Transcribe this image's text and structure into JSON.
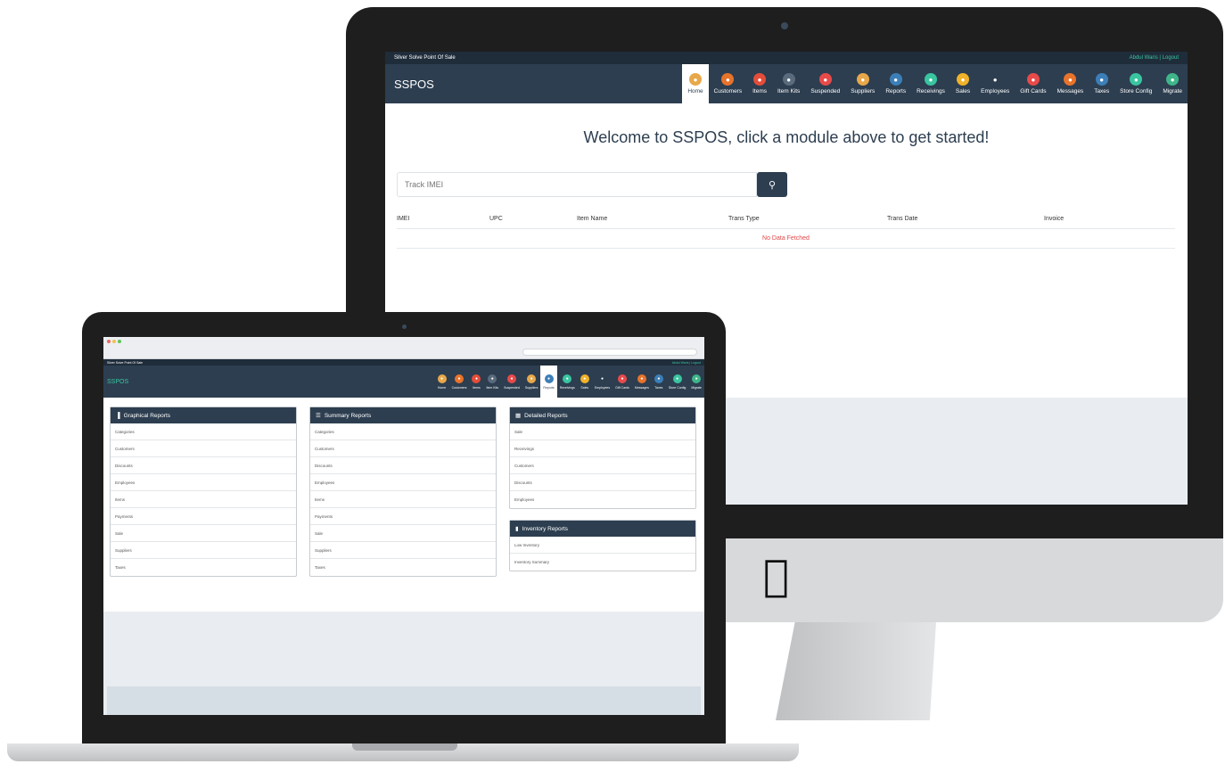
{
  "imac": {
    "topbar": {
      "app_name": "Silver Solve Point Of Sale",
      "user_links": "Abdul Waris | Logout"
    },
    "brand": "SSPOS",
    "modules": [
      {
        "label": "Home",
        "icon": "home-icon",
        "color": "#e8a84a",
        "active": true
      },
      {
        "label": "Customers",
        "icon": "customers-icon",
        "color": "#e8732b",
        "active": false
      },
      {
        "label": "Items",
        "icon": "items-icon",
        "color": "#e44d3a",
        "active": false
      },
      {
        "label": "Item Kits",
        "icon": "item-kits-icon",
        "color": "#5a6b7d",
        "active": false
      },
      {
        "label": "Suspended",
        "icon": "suspended-icon",
        "color": "#e84a4a",
        "active": false
      },
      {
        "label": "Suppliers",
        "icon": "suppliers-icon",
        "color": "#e8a84a",
        "active": false
      },
      {
        "label": "Reports",
        "icon": "reports-icon",
        "color": "#3c7fb8",
        "active": false
      },
      {
        "label": "Receivings",
        "icon": "receivings-icon",
        "color": "#39c5a0",
        "active": false
      },
      {
        "label": "Sales",
        "icon": "sales-icon",
        "color": "#f0b22a",
        "active": false
      },
      {
        "label": "Employees",
        "icon": "employees-icon",
        "color": "#2d3e50",
        "active": false
      },
      {
        "label": "Gift Cards",
        "icon": "gift-cards-icon",
        "color": "#e84a4a",
        "active": false
      },
      {
        "label": "Messages",
        "icon": "messages-icon",
        "color": "#e8732b",
        "active": false
      },
      {
        "label": "Taxes",
        "icon": "taxes-icon",
        "color": "#3c7fb8",
        "active": false
      },
      {
        "label": "Store Config",
        "icon": "store-config-icon",
        "color": "#39c5a0",
        "active": false
      },
      {
        "label": "Migrate",
        "icon": "migrate-icon",
        "color": "#3fb58a",
        "active": false
      }
    ],
    "welcome": "Welcome to SSPOS, click a module above to get started!",
    "search": {
      "placeholder": "Track IMEI",
      "icon": "search-icon"
    },
    "table": {
      "columns": [
        "IMEI",
        "UPC",
        "Item Name",
        "Trans Type",
        "Trans Date",
        "Invoice"
      ],
      "empty_message": "No Data Fetched"
    }
  },
  "laptop": {
    "topbar": {
      "app_name": "Silver Solve Point Of Sale",
      "user_links": "Abdul Waris | Logout"
    },
    "brand": "SSPOS",
    "modules": [
      {
        "label": "Home",
        "icon": "home-icon",
        "color": "#e8a84a",
        "active": false
      },
      {
        "label": "Customers",
        "icon": "customers-icon",
        "color": "#e8732b",
        "active": false
      },
      {
        "label": "Items",
        "icon": "items-icon",
        "color": "#e44d3a",
        "active": false
      },
      {
        "label": "Item Kits",
        "icon": "item-kits-icon",
        "color": "#5a6b7d",
        "active": false
      },
      {
        "label": "Suspended",
        "icon": "suspended-icon",
        "color": "#e84a4a",
        "active": false
      },
      {
        "label": "Suppliers",
        "icon": "suppliers-icon",
        "color": "#e8a84a",
        "active": false
      },
      {
        "label": "Reports",
        "icon": "reports-icon",
        "color": "#3c7fb8",
        "active": true
      },
      {
        "label": "Receivings",
        "icon": "receivings-icon",
        "color": "#39c5a0",
        "active": false
      },
      {
        "label": "Sales",
        "icon": "sales-icon",
        "color": "#f0b22a",
        "active": false
      },
      {
        "label": "Employees",
        "icon": "employees-icon",
        "color": "#2d3e50",
        "active": false
      },
      {
        "label": "Gift Cards",
        "icon": "gift-cards-icon",
        "color": "#e84a4a",
        "active": false
      },
      {
        "label": "Messages",
        "icon": "messages-icon",
        "color": "#e8732b",
        "active": false
      },
      {
        "label": "Taxes",
        "icon": "taxes-icon",
        "color": "#3c7fb8",
        "active": false
      },
      {
        "label": "Store Config",
        "icon": "store-config-icon",
        "color": "#39c5a0",
        "active": false
      },
      {
        "label": "Migrate",
        "icon": "migrate-icon",
        "color": "#3fb58a",
        "active": false
      }
    ],
    "panels": [
      {
        "title": "Graphical Reports",
        "icon": "bar-chart-icon",
        "items": [
          "Categories",
          "Customers",
          "Discounts",
          "Employees",
          "Items",
          "Payments",
          "Sale",
          "Suppliers",
          "Taxes"
        ]
      },
      {
        "title": "Summary Reports",
        "icon": "list-icon",
        "items": [
          "Categories",
          "Customers",
          "Discounts",
          "Employees",
          "Items",
          "Payments",
          "Sale",
          "Suppliers",
          "Taxes"
        ]
      },
      {
        "title": "Detailed Reports",
        "icon": "calendar-icon",
        "items": [
          "Sale",
          "Receivings",
          "Customers",
          "Discounts",
          "Employees"
        ]
      },
      {
        "title": "Inventory Reports",
        "icon": "book-icon",
        "items": [
          "Low Inventory",
          "Inventory Summary"
        ]
      }
    ]
  }
}
